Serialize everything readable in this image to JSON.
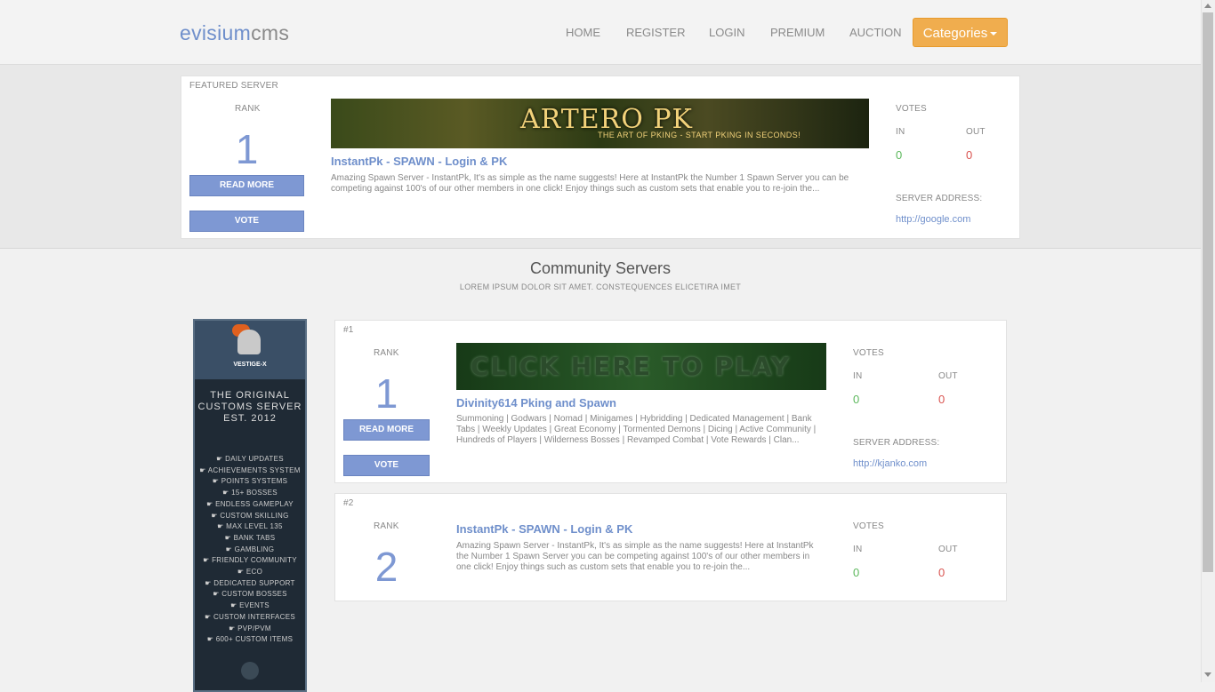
{
  "brand": {
    "part1": "evisium",
    "part2": "cms"
  },
  "nav": {
    "home": "HOME",
    "register": "REGISTER",
    "login": "LOGIN",
    "premium": "PREMIUM",
    "auction": "AUCTION",
    "categories": "Categories"
  },
  "featured": {
    "label": "FEATURED SERVER",
    "rank_label": "RANK",
    "rank": "1",
    "read_more": "READ MORE",
    "vote": "VOTE",
    "banner_title": "ARTERO PK",
    "banner_sub": "THE ART OF PKING - START PKING IN SECONDS!",
    "title": "InstantPk - SPAWN - Login & PK",
    "desc": "Amazing Spawn Server - InstantPk, It's as simple as the name suggests! Here at InstantPk the Number 1 Spawn Server you can be competing against 100's of our other members in one click! Enjoy things such as custom sets that enable you to re-join the...",
    "votes_label": "VOTES",
    "in_label": "IN",
    "out_label": "OUT",
    "in": "0",
    "out": "0",
    "address_label": "SERVER ADDRESS:",
    "address": "http://google.com"
  },
  "community": {
    "title": "Community Servers",
    "subtitle": "LOREM IPSUM DOLOR SIT AMET. CONSTEQUENCES ELICETIRA IMET"
  },
  "ad": {
    "name": "VESTIGE-X",
    "line1": "THE ORIGINAL",
    "line2": "CUSTOMS SERVER",
    "line3": "EST. 2012",
    "features": [
      "DAILY UPDATES",
      "ACHIEVEMENTS SYSTEM",
      "POINTS SYSTEMS",
      "15+ BOSSES",
      "ENDLESS GAMEPLAY",
      "CUSTOM SKILLING",
      "MAX LEVEL 135",
      "BANK TABS",
      "GAMBLING",
      "FRIENDLY COMMUNITY",
      "ECO",
      "DEDICATED SUPPORT",
      "CUSTOM BOSSES",
      "EVENTS",
      "CUSTOM INTERFACES",
      "PVP/PVM",
      "600+ CUSTOM ITEMS"
    ]
  },
  "servers": [
    {
      "pos": "#1",
      "rank_label": "RANK",
      "rank": "1",
      "read_more": "READ MORE",
      "vote": "VOTE",
      "banner_text": "CLICK HERE TO PLAY",
      "title": "Divinity614 Pking and Spawn",
      "desc": "Summoning | Godwars | Nomad | Minigames | Hybridding | Dedicated Management | Bank Tabs | Weekly Updates | Great Economy | Tormented Demons | Dicing | Active Community | Hundreds of Players | Wilderness Bosses | Revamped Combat | Vote Rewards | Clan...",
      "votes_label": "VOTES",
      "in_label": "IN",
      "out_label": "OUT",
      "in": "0",
      "out": "0",
      "address_label": "SERVER ADDRESS:",
      "address": "http://kjanko.com"
    },
    {
      "pos": "#2",
      "rank_label": "RANK",
      "rank": "2",
      "title": "InstantPk - SPAWN - Login & PK",
      "desc": "Amazing Spawn Server - InstantPk, It's as simple as the name suggests! Here at InstantPk the Number 1 Spawn Server you can be competing against 100's of our other members in one click! Enjoy things such as custom sets that enable you to re-join the...",
      "votes_label": "VOTES",
      "in_label": "IN",
      "out_label": "OUT",
      "in": "0",
      "out": "0"
    }
  ]
}
